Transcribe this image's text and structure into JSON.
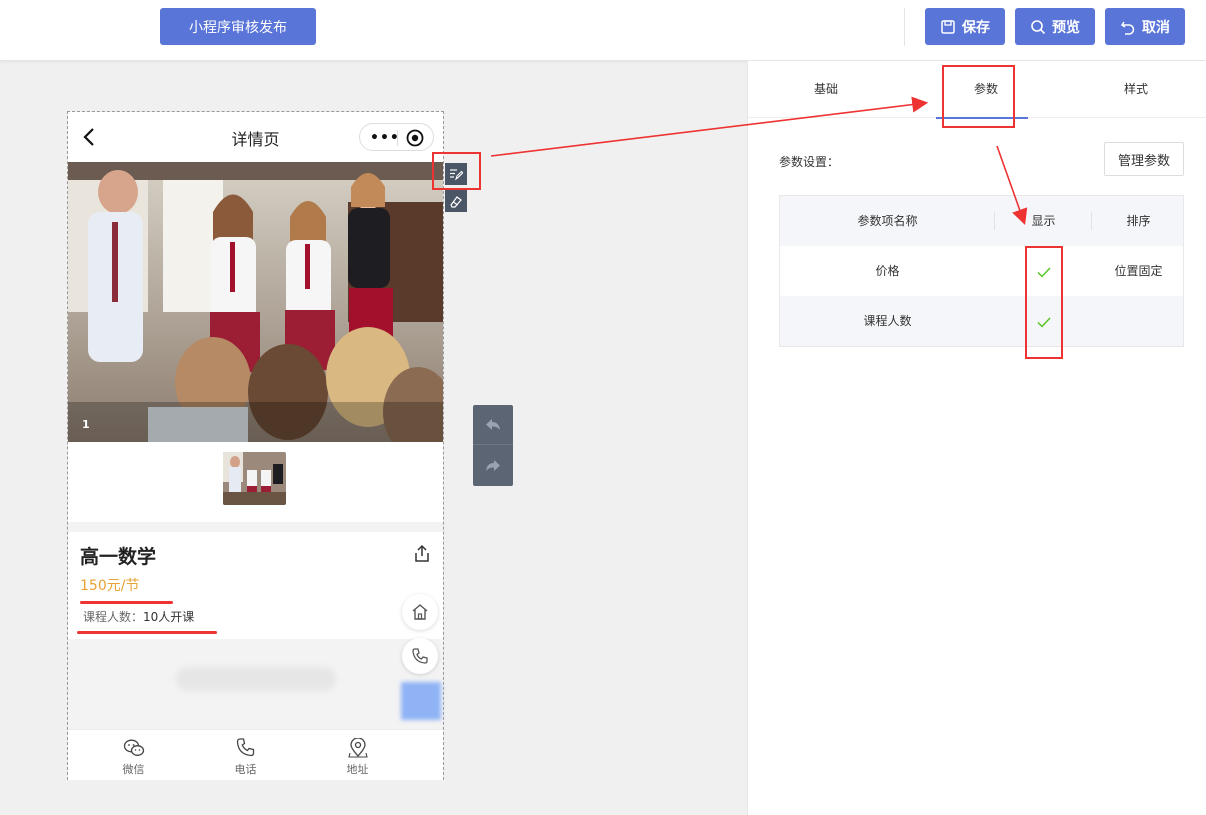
{
  "topbar": {
    "publish_label": "小程序审核发布",
    "save_label": "保存",
    "preview_label": "预览",
    "cancel_label": "取消"
  },
  "panel": {
    "tabs": [
      {
        "label": "基础"
      },
      {
        "label": "参数",
        "active": true
      },
      {
        "label": "样式"
      }
    ],
    "param_settings_label": "参数设置：",
    "manage_button_label": "管理参数",
    "table": {
      "headers": {
        "name": "参数项名称",
        "show": "显示",
        "sort": "排序"
      },
      "rows": [
        {
          "name": "价格",
          "show": true,
          "sort": "位置固定"
        },
        {
          "name": "课程人数",
          "show": true,
          "sort": ""
        }
      ]
    }
  },
  "phone": {
    "nav_title": "详情页",
    "banner_index": "1",
    "course_title": "高一数学",
    "price": "150元/节",
    "people_label": "课程人数：",
    "people_value": "10人开课",
    "bottom_bar": [
      {
        "label": "微信",
        "icon": "wechat-icon"
      },
      {
        "label": "电话",
        "icon": "phone-icon"
      },
      {
        "label": "地址",
        "icon": "location-icon"
      }
    ]
  },
  "colors": {
    "accent": "#5a75d8",
    "price": "#e9a234",
    "check": "#52c41a",
    "annotation": "#e33333"
  }
}
